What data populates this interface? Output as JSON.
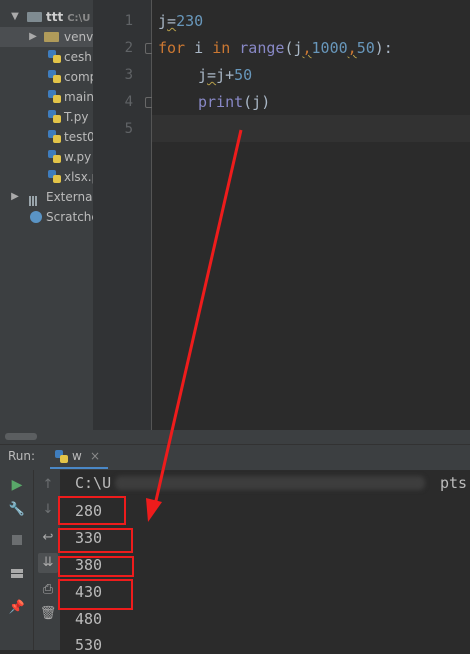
{
  "project_tree": {
    "root": {
      "name": "ttt",
      "path": "C:\\U"
    },
    "items": [
      {
        "name": "venv"
      },
      {
        "name": "ceshi"
      },
      {
        "name": "comp"
      },
      {
        "name": "main"
      },
      {
        "name": "T.py"
      },
      {
        "name": "test0"
      },
      {
        "name": "w.py"
      },
      {
        "name": "xlsx.p"
      }
    ],
    "external": "External",
    "scratches": "Scratche"
  },
  "editor": {
    "line_numbers": [
      "1",
      "2",
      "3",
      "4",
      "5"
    ],
    "code_lines": [
      {
        "parts": [
          "j",
          "=",
          "230"
        ]
      },
      {
        "parts": [
          "for",
          " i ",
          "in",
          " ",
          "range",
          "(j",
          ",",
          "1000",
          ",",
          "50",
          "):"
        ]
      },
      {
        "parts": [
          "j",
          "=",
          "j+",
          "50"
        ]
      },
      {
        "parts": [
          "print",
          "(j)"
        ]
      }
    ]
  },
  "run_panel": {
    "label": "Run:",
    "tab_name": "w",
    "tab_close": "×",
    "output_path": "C:\\U",
    "output_path_tail": "pts",
    "output_lines": [
      "280",
      "330",
      "380",
      "430",
      "480",
      "530"
    ]
  },
  "colors": {
    "annotation_red": "#ee1c1c",
    "keyword": "#cc7832",
    "number": "#6897bb",
    "builtin": "#8888c6"
  }
}
